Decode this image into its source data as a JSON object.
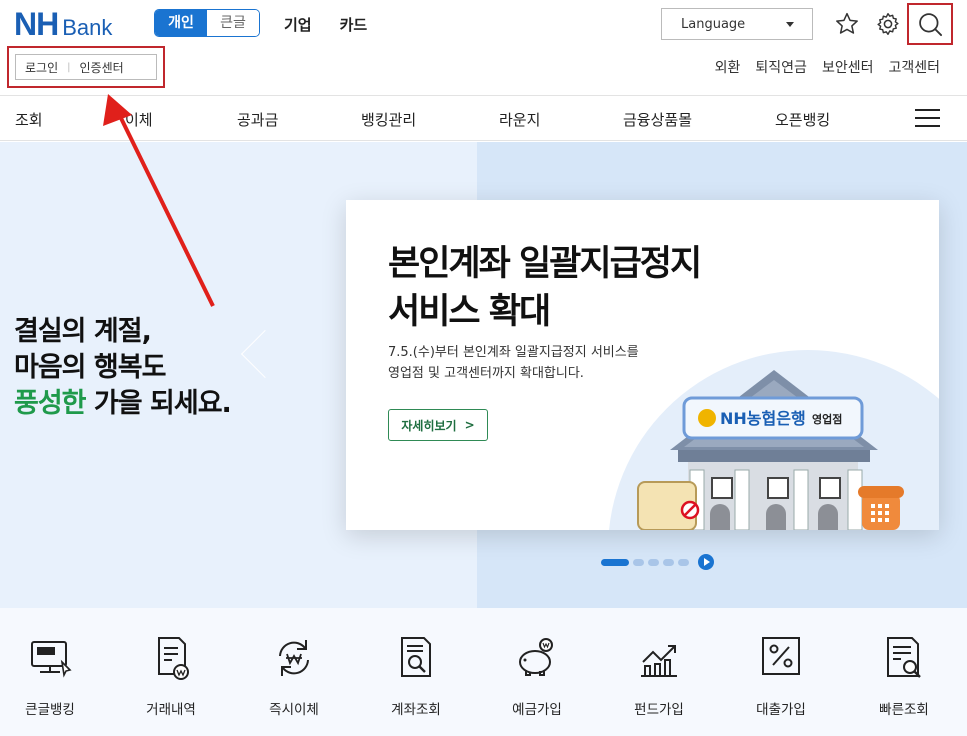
{
  "header": {
    "logo_nh": "NH",
    "logo_bank": "Bank",
    "segment": {
      "personal": "개인",
      "large": "큰글"
    },
    "top_nav": [
      "기업",
      "카드"
    ],
    "language": "Language",
    "login": "로그인",
    "cert_center": "인증센터",
    "util_nav": [
      "외환",
      "퇴직연금",
      "보안센터",
      "고객센터"
    ]
  },
  "main_nav": [
    "조회",
    "이체",
    "공과금",
    "뱅킹관리",
    "라운지",
    "금융상품몰",
    "오픈뱅킹"
  ],
  "hero": {
    "left_line1": "결실의 계절,",
    "left_line2": "마음의 행복도",
    "left_line3_green": "풍성한",
    "left_line3_rest": " 가을 되세요.",
    "card_title_1": "본인계좌 일괄지급정지",
    "card_title_2": "서비스 확대",
    "card_desc_1": "7.5.(수)부터 본인계좌 일괄지급정지 서비스를",
    "card_desc_2": "영업점 및 고객센터까지 확대합니다.",
    "card_button": "자세히보기",
    "sign_text": "NH농협은행",
    "sign_sub": "영업점"
  },
  "quick_menu": [
    "큰글뱅킹",
    "거래내역",
    "즉시이체",
    "계좌조회",
    "예금가입",
    "펀드가입",
    "대출가입",
    "빠른조회"
  ],
  "colors": {
    "brand": "#1a74d1",
    "green": "#1f9a4b",
    "highlight": "#c0272d"
  }
}
